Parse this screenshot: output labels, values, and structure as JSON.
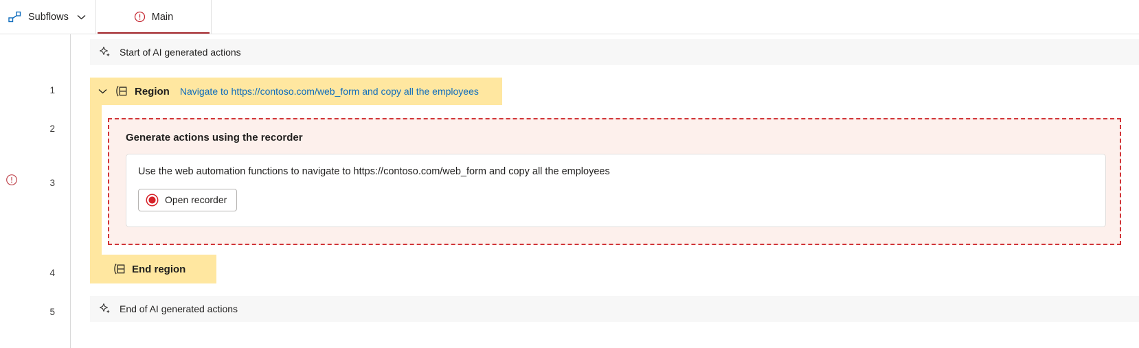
{
  "colors": {
    "accent_link": "#0f6cbd",
    "region_yellow": "#ffe7a0",
    "error_red": "#d13438",
    "tab_underline": "#a4262c",
    "ai_row_bg": "#f7f7f7",
    "recorder_bg": "#fdf0ec"
  },
  "topbar": {
    "subflows": {
      "label": "Subflows",
      "icon": "subflows-icon",
      "chevron": "chevron-down-icon"
    },
    "tabs": [
      {
        "label": "Main",
        "icon": "error-circle-icon",
        "selected": true
      }
    ]
  },
  "gutter": {
    "line_numbers": [
      "1",
      "2",
      "3",
      "4",
      "5"
    ],
    "error_marker_row": "3",
    "error_icon": "error-circle-icon"
  },
  "flow": {
    "rows": [
      {
        "number": "1",
        "type": "ai-marker",
        "icon": "sparkle-icon",
        "text": "Start of AI generated actions"
      },
      {
        "number": "2",
        "type": "region-start",
        "icon": "region-icon",
        "expander": "chevron-down-icon",
        "title": "Region",
        "description": "Navigate to https://contoso.com/web_form and copy all the employees"
      },
      {
        "number": "3",
        "type": "recorder-card",
        "heading": "Generate actions using the recorder",
        "prompt": "Use the web automation functions to navigate to https://contoso.com/web_form and copy all the employees",
        "button": {
          "label": "Open recorder",
          "icon": "record-circle-icon"
        }
      },
      {
        "number": "4",
        "type": "region-end",
        "icon": "region-icon",
        "text": "End region"
      },
      {
        "number": "5",
        "type": "ai-marker",
        "icon": "sparkle-icon",
        "text": "End of AI generated actions"
      }
    ]
  }
}
